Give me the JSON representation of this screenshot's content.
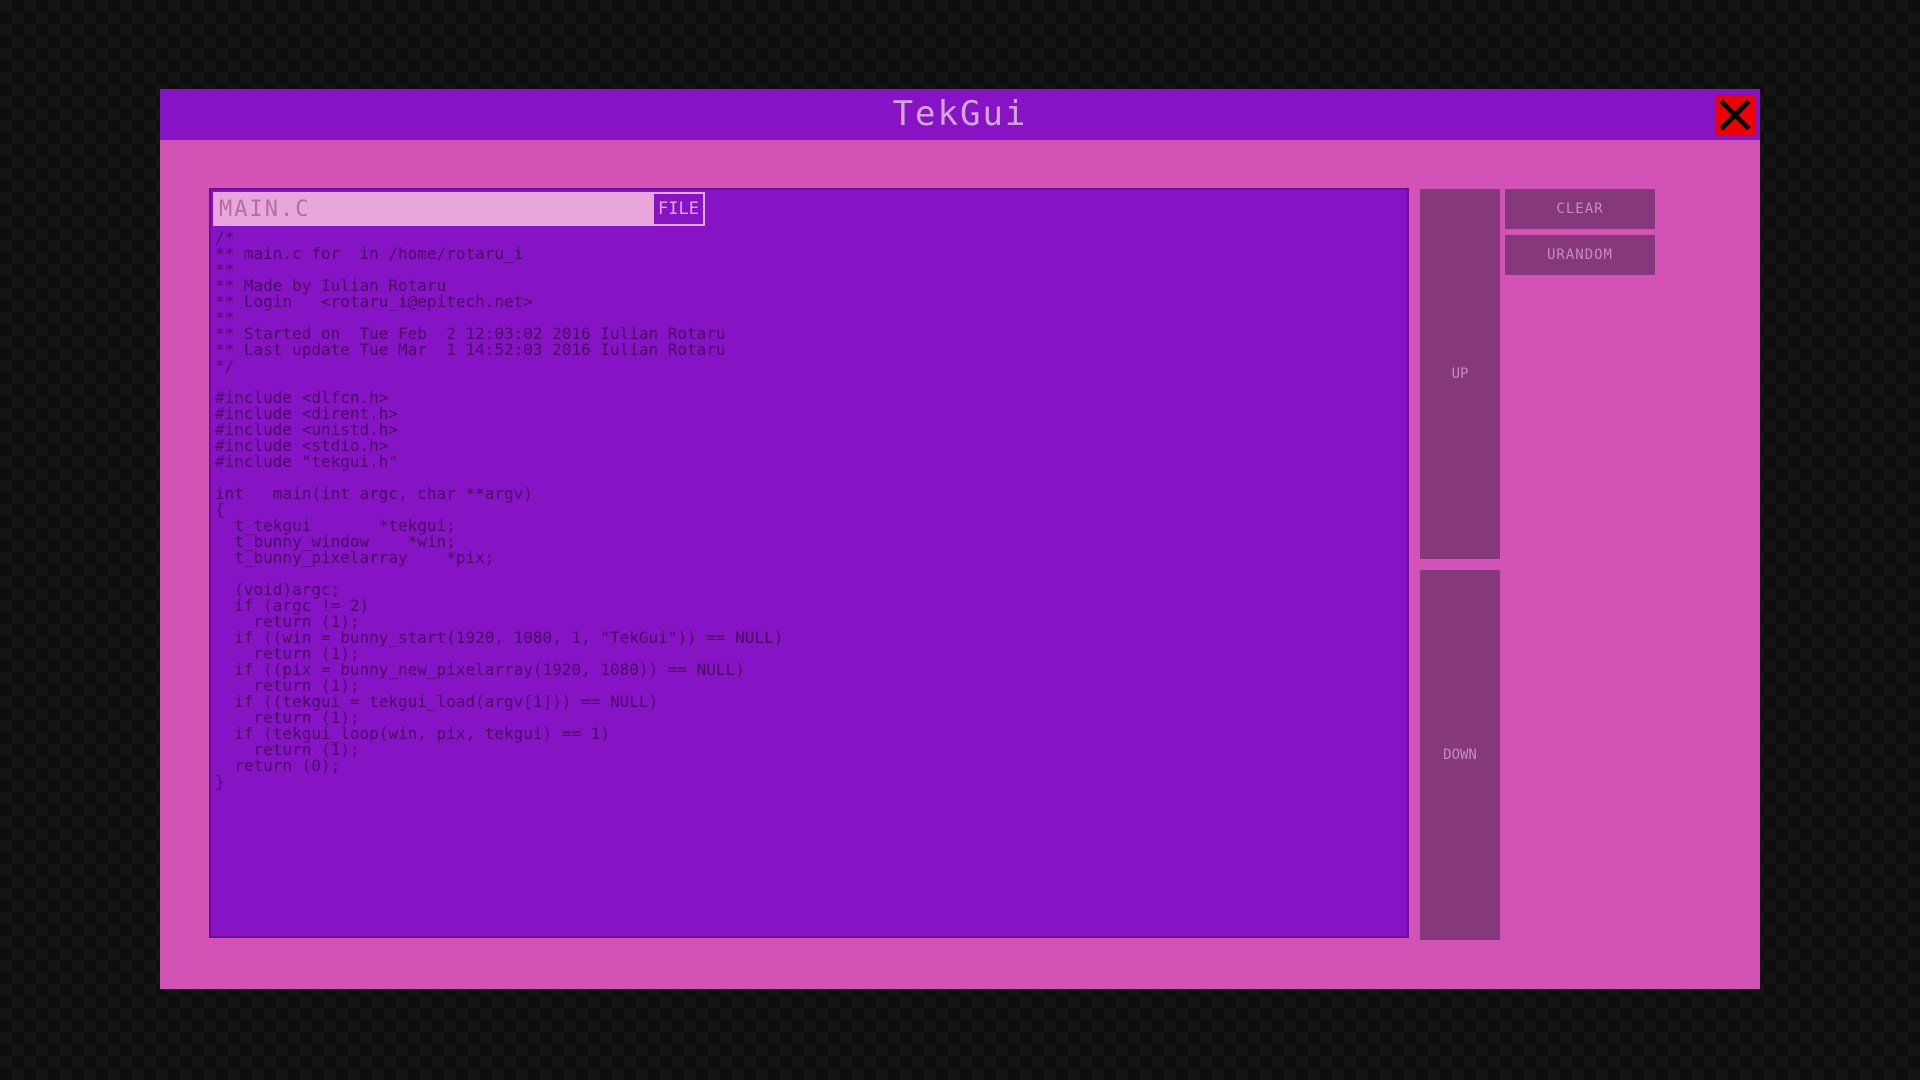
{
  "window": {
    "title": "TekGui",
    "close_icon": "close-x-icon"
  },
  "file": {
    "value": "MAIN.C",
    "button_label": "FILE"
  },
  "buttons": {
    "up": "UP",
    "down": "DOWN",
    "clear": "CLEAR",
    "random": "URANDOM"
  },
  "code": "/*\n** main.c for  in /home/rotaru_i\n**\n** Made by Iulian Rotaru\n** Login   <rotaru_i@epitech.net>\n**\n** Started on  Tue Feb  2 12:03:02 2016 Iulian Rotaru\n** Last update Tue Mar  1 14:52:03 2016 Iulian Rotaru\n*/\n\n#include <dlfcn.h>\n#include <dirent.h>\n#include <unistd.h>\n#include <stdio.h>\n#include \"tekgui.h\"\n\nint   main(int argc, char **argv)\n{\n  t_tekgui       *tekgui;\n  t_bunny_window    *win;\n  t_bunny_pixelarray    *pix;\n\n  (void)argc;\n  if (argc != 2)\n    return (1);\n  if ((win = bunny_start(1920, 1080, 1, \"TekGui\")) == NULL)\n    return (1);\n  if ((pix = bunny_new_pixelarray(1920, 1080)) == NULL)\n    return (1);\n  if ((tekgui = tekgui_load(argv[1])) == NULL)\n    return (1);\n  if (tekgui_loop(win, pix, tekgui) == 1)\n    return (1);\n  return (0);\n}",
  "colors": {
    "desktop": "#141414",
    "window_bg": "#d352b5",
    "titlebar": "#8614c4",
    "editor_bg": "#8614c4",
    "code_text": "#470a63",
    "button_bg": "#85387b",
    "button_text": "#c88bc1",
    "close_bg": "#ee0000"
  }
}
